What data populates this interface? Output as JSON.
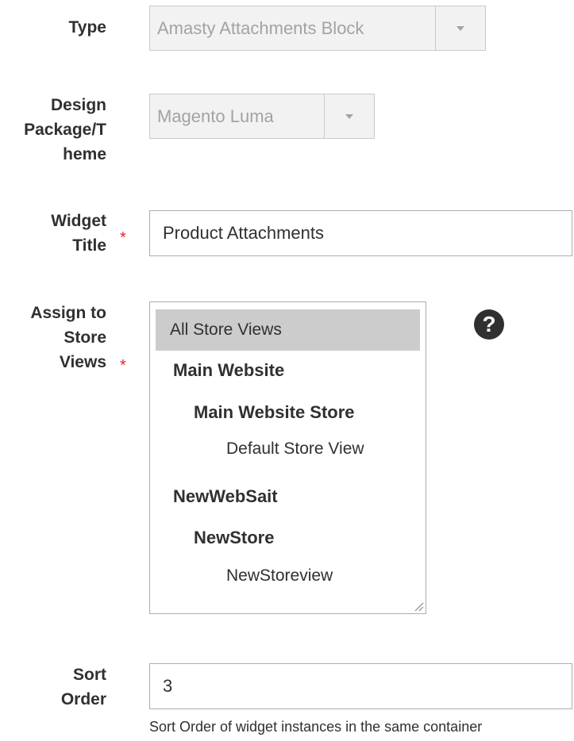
{
  "form": {
    "type": {
      "label": "Type",
      "value": "Amasty Attachments Block"
    },
    "design": {
      "label_line1": "Design",
      "label_line2": "Package/T",
      "label_line3": "heme",
      "value": "Magento Luma"
    },
    "widget_title": {
      "label_line1": "Widget",
      "label_line2": "Title",
      "required_mark": "*",
      "value": "Product Attachments"
    },
    "store_views": {
      "label_line1": "Assign to",
      "label_line2": "Store",
      "label_line3": "Views",
      "required_mark": "*",
      "help_icon": "?",
      "options": {
        "all": "All Store Views",
        "main_website": "Main Website",
        "main_website_store": "Main Website Store",
        "default_store_view": "Default Store View",
        "newwebsait": "NewWebSait",
        "newstore": "NewStore",
        "newstoreview": "NewStoreview"
      }
    },
    "sort_order": {
      "label_line1": "Sort",
      "label_line2": "Order",
      "value": "3",
      "note": "Sort Order of widget instances in the same container"
    }
  },
  "colors": {
    "required": "#e22626",
    "selected_option_bg": "#cccccc",
    "disabled_bg": "#f2f2f2"
  }
}
